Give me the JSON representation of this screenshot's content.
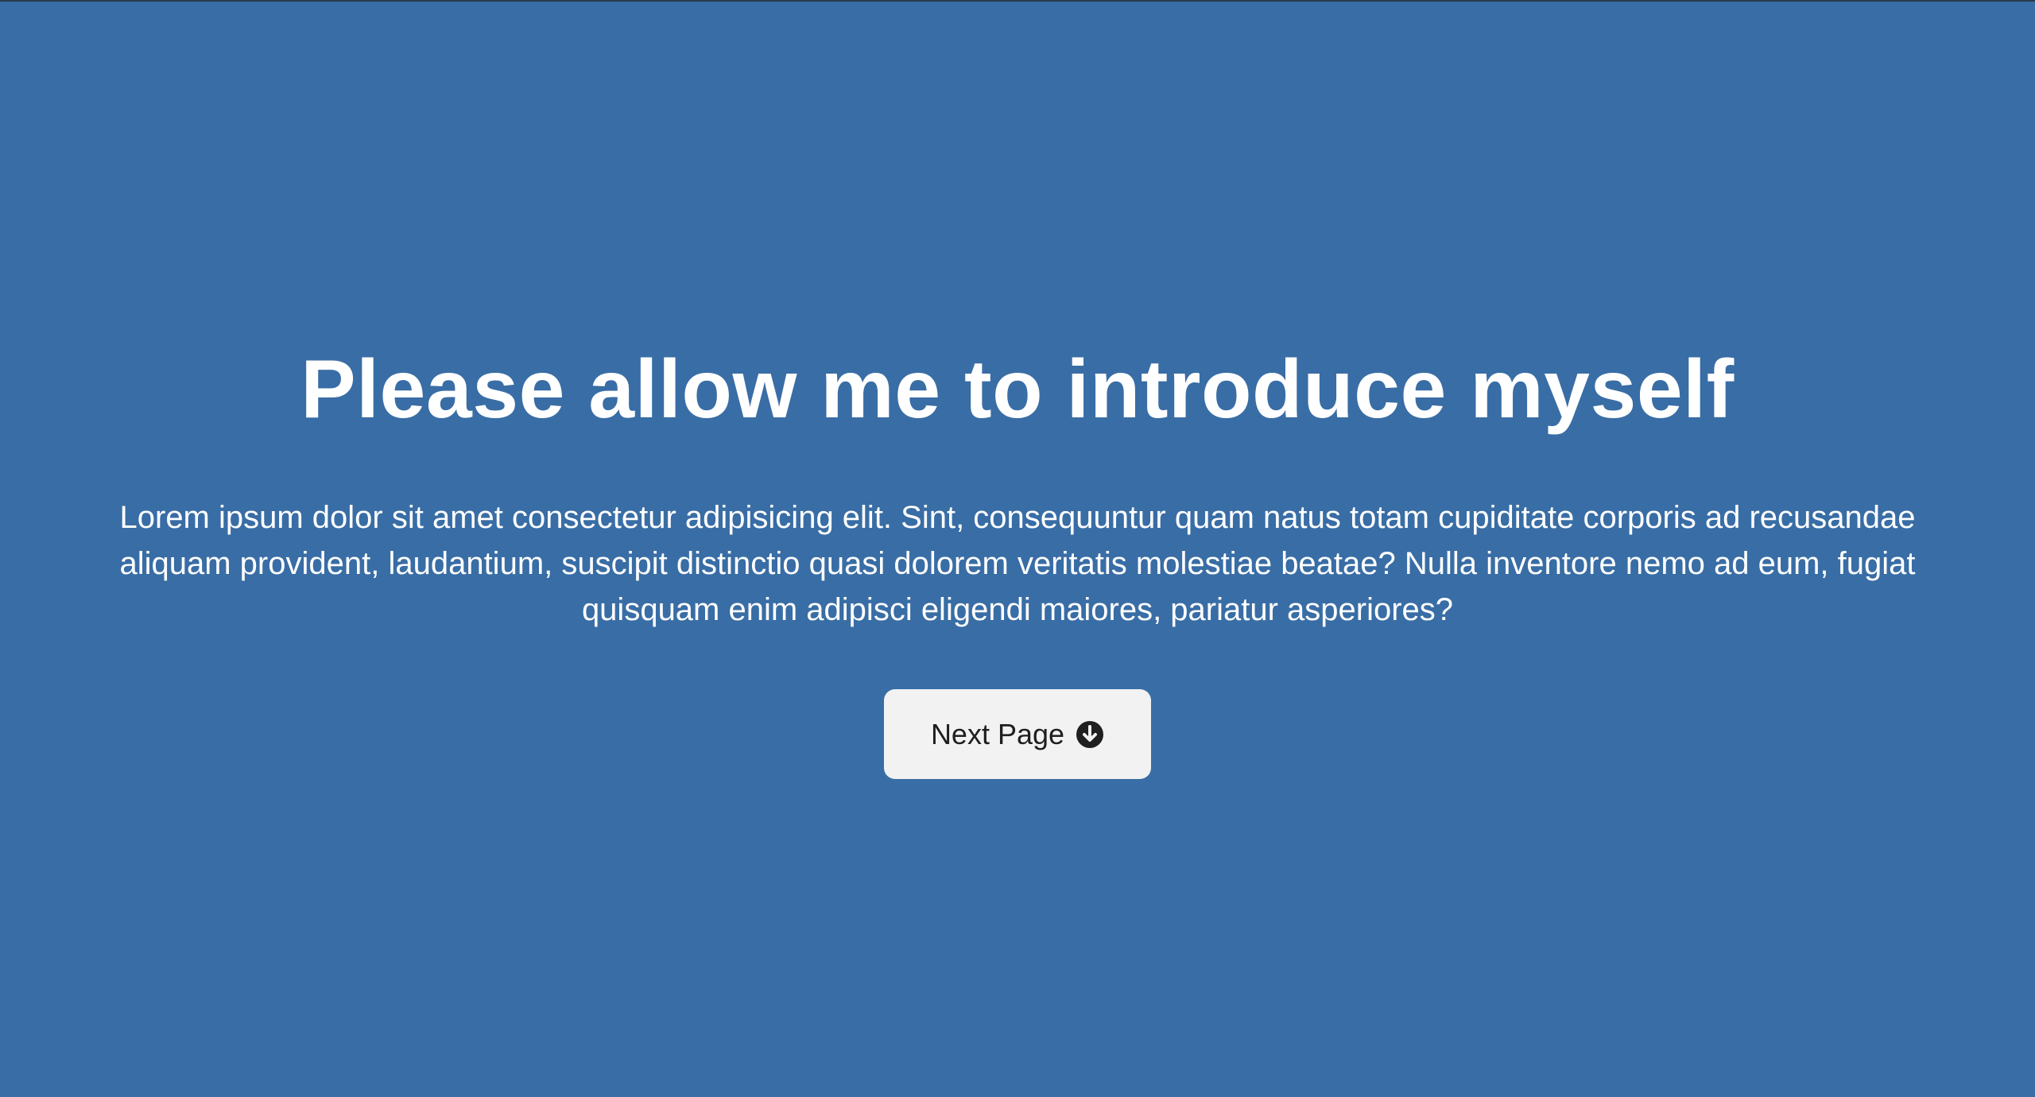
{
  "hero": {
    "title": "Please allow me to introduce myself",
    "text": "Lorem ipsum dolor sit amet consectetur adipisicing elit. Sint, consequuntur quam natus totam cupiditate corporis ad recusandae aliquam provident, laudantium, suscipit distinctio quasi dolorem veritatis molestiae beatae? Nulla inventore nemo ad eum, fugiat quisquam enim adipisci eligendi maiores, pariatur asperiores?",
    "button": {
      "label": "Next Page",
      "icon": "arrow-circle-down-icon"
    }
  },
  "colors": {
    "background": "#396da5",
    "text": "#ffffff",
    "button_background": "#f2f2f2",
    "button_text": "#1f1f1f"
  }
}
